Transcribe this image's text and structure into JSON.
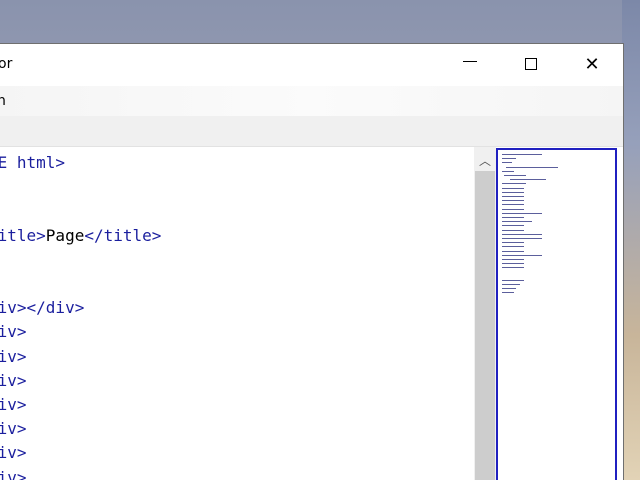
{
  "window": {
    "title": "or",
    "controls": {
      "minimize": "minimize",
      "maximize": "maximize",
      "close": "✕"
    }
  },
  "menu": {
    "items": [
      {
        "label": "n"
      }
    ]
  },
  "editor": {
    "lines": [
      {
        "parts": [
          {
            "t": "PE html>",
            "k": "tag"
          }
        ]
      },
      {
        "parts": []
      },
      {
        "parts": []
      },
      {
        "parts": [
          {
            "t": "title>",
            "k": "tag"
          },
          {
            "t": "Page",
            "k": "text"
          },
          {
            "t": "</title>",
            "k": "tag"
          }
        ]
      },
      {
        "parts": []
      },
      {
        "parts": []
      },
      {
        "parts": [
          {
            "t": "div></div>",
            "k": "tag"
          }
        ]
      },
      {
        "parts": [
          {
            "t": "div>",
            "k": "tag"
          }
        ]
      },
      {
        "parts": [
          {
            "t": "div>",
            "k": "tag"
          }
        ]
      },
      {
        "parts": [
          {
            "t": "div>",
            "k": "tag"
          }
        ]
      },
      {
        "parts": [
          {
            "t": "div>",
            "k": "tag"
          }
        ]
      },
      {
        "parts": [
          {
            "t": "div>",
            "k": "tag"
          }
        ]
      },
      {
        "parts": [
          {
            "t": "div>",
            "k": "tag"
          }
        ]
      },
      {
        "parts": [
          {
            "t": "div>",
            "k": "tag"
          }
        ]
      }
    ]
  },
  "scrollbar": {
    "up_arrow": "︿"
  },
  "colors": {
    "tag": "#1b1f9e",
    "text": "#000000",
    "minimap_border": "#2020c0"
  }
}
